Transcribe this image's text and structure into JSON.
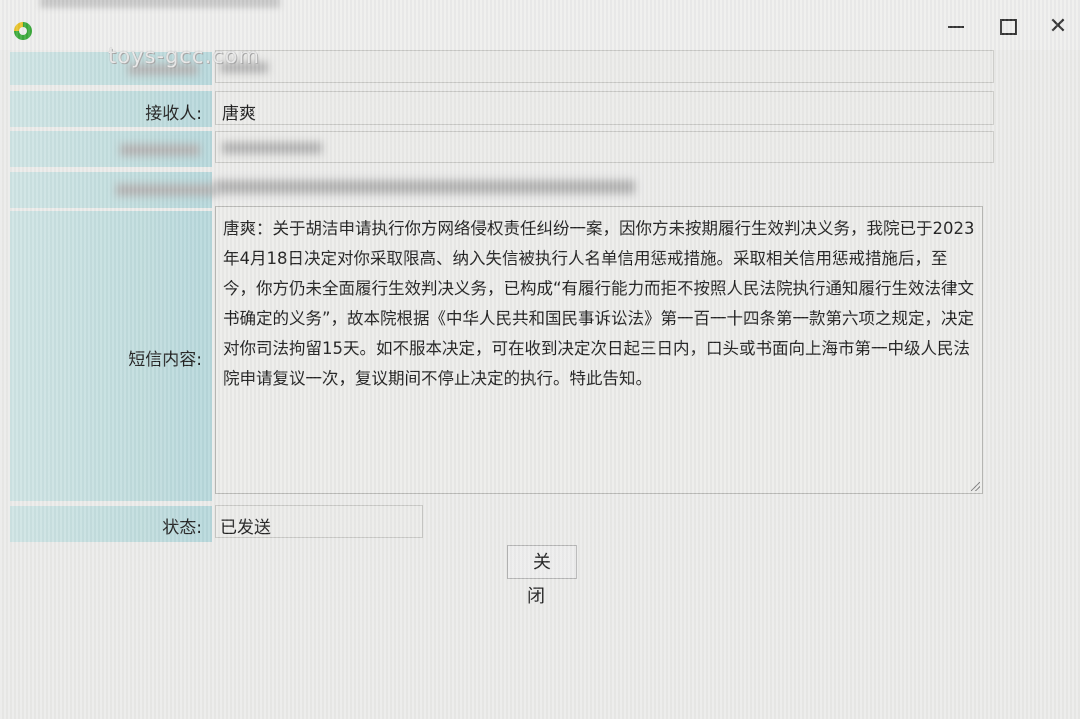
{
  "window": {
    "watermark": "toys-gcc.com",
    "close_glyph": "✕"
  },
  "form": {
    "recipient_label": "接收人:",
    "recipient_value": "唐爽",
    "message_label": "短信内容:",
    "message_text": "唐爽：关于胡洁申请执行你方网络侵权责任纠纷一案，因你方未按期履行生效判决义务，我院已于2023年4月18日决定对你采取限高、纳入失信被执行人名单信用惩戒措施。采取相关信用惩戒措施后，至今，你方仍未全面履行生效判决义务，已构成“有履行能力而拒不按照人民法院执行通知履行生效法律文书确定的义务”，故本院根据《中华人民共和国民事诉讼法》第一百一十四条第一款第六项之规定，决定对你司法拘留15天。如不服本决定，可在收到决定次日起三日内，口头或书面向上海市第一中级人民法院申请复议一次，复议期间不停止决定的执行。特此告知。",
    "status_label": "状态:",
    "status_value": "已发送"
  },
  "actions": {
    "close_label": "关闭"
  },
  "icons": {
    "app": "app-logo-icon",
    "minimize": "minimize-icon",
    "maximize": "maximize-icon",
    "close": "close-icon"
  }
}
